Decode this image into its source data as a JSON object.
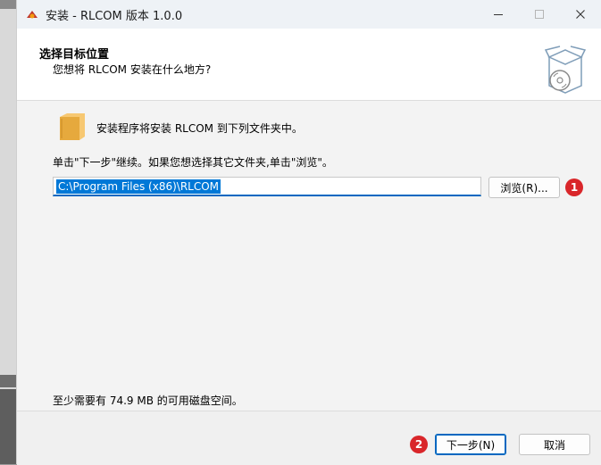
{
  "window": {
    "title": "安装 - RLCOM 版本 1.0.0"
  },
  "header": {
    "title": "选择目标位置",
    "subtitle": "您想将 RLCOM 安装在什么地方?"
  },
  "main": {
    "install_line": "安装程序将安装 RLCOM 到下列文件夹中。",
    "instruction": "单击\"下一步\"继续。如果您想选择其它文件夹,单击\"浏览\"。",
    "path_value": "C:\\Program Files (x86)\\RLCOM",
    "browse_label": "浏览(R)...",
    "disk_space": "至少需要有 74.9 MB 的可用磁盘空间。"
  },
  "footer": {
    "next_label": "下一步(N)",
    "cancel_label": "取消"
  },
  "badges": {
    "one": "1",
    "two": "2"
  },
  "icons": {
    "app": "app-icon",
    "minimize": "minimize-icon",
    "maximize": "maximize-icon",
    "close": "close-icon",
    "wizard": "disc-box-icon",
    "folder": "folder-icon"
  },
  "colors": {
    "accent": "#0067c0",
    "selection": "#0078d7",
    "badge": "#d9262a"
  }
}
